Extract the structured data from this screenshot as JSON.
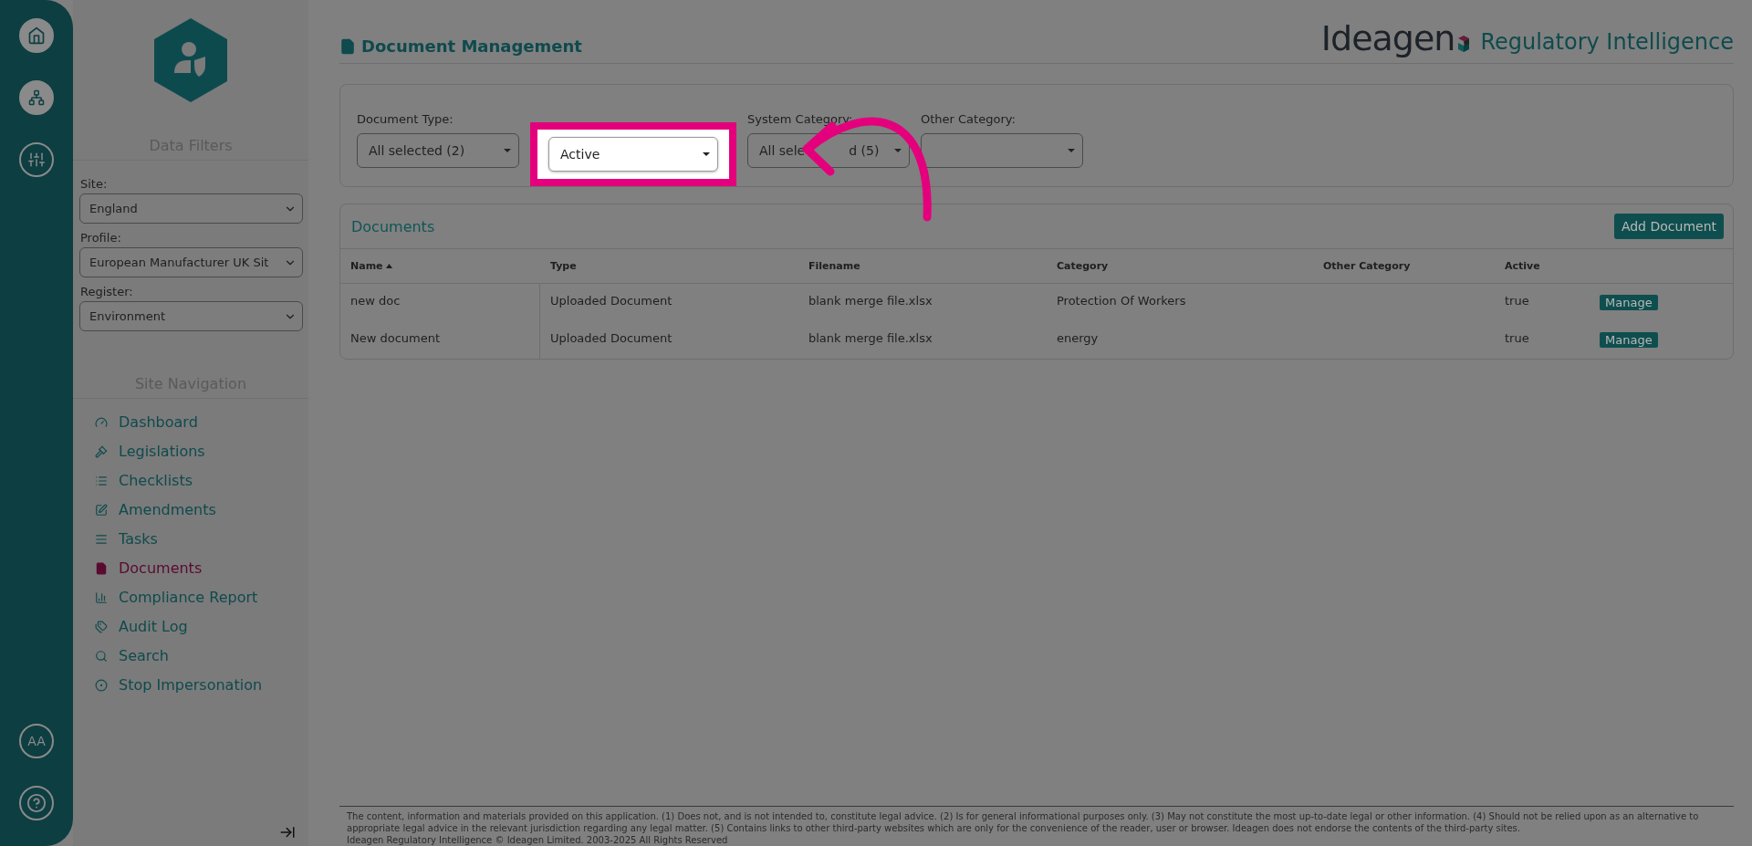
{
  "rail": {
    "avatar_initials": "AA"
  },
  "sidebar": {
    "data_filters_title": "Data Filters",
    "filters": [
      {
        "label": "Site:",
        "value": "England"
      },
      {
        "label": "Profile:",
        "value": "European Manufacturer UK Sit"
      },
      {
        "label": "Register:",
        "value": "Environment"
      }
    ],
    "navigation_title": "Site Navigation",
    "nav_items": [
      {
        "label": "Dashboard",
        "selected": false
      },
      {
        "label": "Legislations",
        "selected": false
      },
      {
        "label": "Checklists",
        "selected": false
      },
      {
        "label": "Amendments",
        "selected": false
      },
      {
        "label": "Tasks",
        "selected": false
      },
      {
        "label": "Documents",
        "selected": true
      },
      {
        "label": "Compliance Report",
        "selected": false
      },
      {
        "label": "Audit Log",
        "selected": false
      },
      {
        "label": "Search",
        "selected": false
      },
      {
        "label": "Stop Impersonation",
        "selected": false
      }
    ]
  },
  "header": {
    "title": "Document Management",
    "brand": "Ideagen",
    "product": "Regulatory Intelligence"
  },
  "filters": [
    {
      "label": "Document Type:",
      "value": "All selected (2)",
      "highlighted": false
    },
    {
      "value": "Active",
      "highlighted": true
    },
    {
      "label": "System Category:",
      "value_parts": [
        "All sele",
        "d (5)"
      ],
      "highlighted": false
    },
    {
      "label": "Other Category:",
      "highlighted": false
    }
  ],
  "documents": {
    "title": "Documents",
    "add_button": "Add Document",
    "columns": [
      {
        "label": "Name",
        "sorted": true
      },
      {
        "label": "Type"
      },
      {
        "label": "Filename"
      },
      {
        "label": "Category"
      },
      {
        "label": "Other Category"
      },
      {
        "label": "Active"
      }
    ],
    "rows": [
      {
        "cells": [
          "new doc",
          "Uploaded Document",
          "blank merge file.xlsx",
          "Protection Of Workers",
          "",
          "true"
        ],
        "action": "Manage"
      },
      {
        "cells": [
          "New document",
          "Uploaded Document",
          "blank merge file.xlsx",
          "energy",
          "",
          "true"
        ],
        "action": "Manage"
      }
    ]
  },
  "footer": {
    "disclaimer": "The content, information and materials provided on this application. (1) Does not, and is not intended to, constitute legal advice. (2) Is for general informational purposes only. (3) May not constitute the most up-to-date legal or other information. (4) Should not be relied upon as an alternative to appropriate legal advice in the relevant jurisdiction regarding any legal matter. (5) Contains links to other third-party websites which are only for the convenience of the reader, user or browser. Ideagen does not endorse the contents of the third-party sites.",
    "copyright": "Ideagen Regulatory Intelligence © Ideagen Limited. 2003-2025 All Rights Reserved"
  }
}
